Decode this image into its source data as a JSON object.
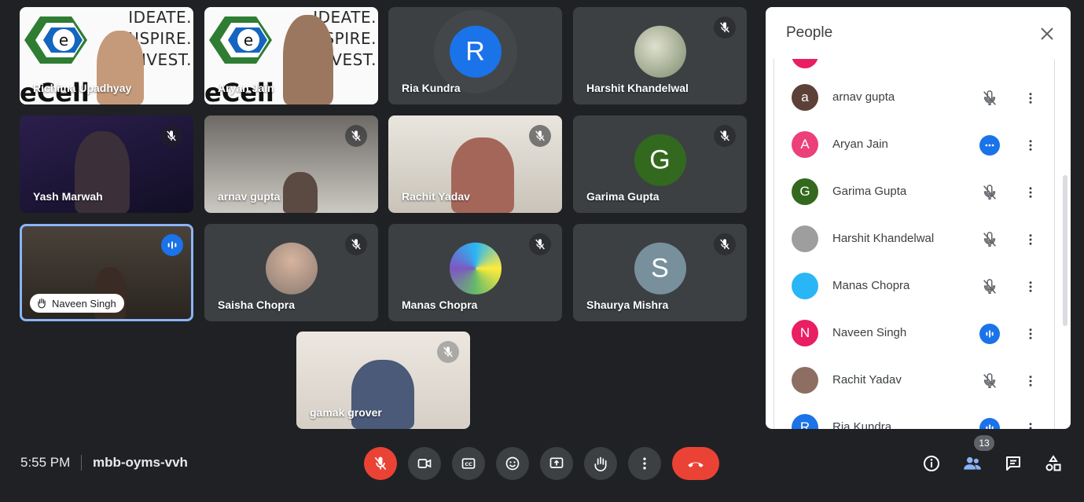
{
  "tiles": [
    {
      "name": "Richima Upadhyay"
    },
    {
      "name": "Aryan Jain"
    },
    {
      "name": "Ria Kundra",
      "initial": "R"
    },
    {
      "name": "Harshit Khandelwal"
    },
    {
      "name": "Yash Marwah"
    },
    {
      "name": "arnav gupta"
    },
    {
      "name": "Rachit Yadav"
    },
    {
      "name": "Garima Gupta",
      "initial": "G"
    },
    {
      "name": "Naveen Singh"
    },
    {
      "name": "Saisha Chopra"
    },
    {
      "name": "Manas Chopra"
    },
    {
      "name": "Shaurya Mishra",
      "initial": "S"
    },
    {
      "name": "gamak grover"
    }
  ],
  "logo": {
    "line1": "IDEATE.",
    "line2": "INSPIRE.",
    "line3": "INVEST.",
    "brand": "eCell IIT"
  },
  "meeting": {
    "time": "5:55 PM",
    "code": "mbb-oyms-vvh",
    "participant_count": "13"
  },
  "panel": {
    "title": "People",
    "people": [
      {
        "name": "arnav gupta",
        "initial": "a",
        "color": "#5d4037",
        "status": "muted"
      },
      {
        "name": "Aryan Jain",
        "initial": "A",
        "color": "#ec407a",
        "status": "speaking-dots"
      },
      {
        "name": "Garima Gupta",
        "initial": "G",
        "color": "#33691e",
        "status": "muted"
      },
      {
        "name": "Harshit Khandelwal",
        "initial": "",
        "color": "#9e9e9e",
        "status": "muted"
      },
      {
        "name": "Manas Chopra",
        "initial": "",
        "color": "#29b6f6",
        "status": "muted"
      },
      {
        "name": "Naveen Singh",
        "initial": "N",
        "color": "#e91e63",
        "status": "speaking"
      },
      {
        "name": "Rachit Yadav",
        "initial": "",
        "color": "#8d6e63",
        "status": "muted"
      },
      {
        "name": "Ria Kundra",
        "initial": "R",
        "color": "#1a73e8",
        "status": "speaking"
      }
    ]
  },
  "colors": {
    "accent": "#1a73e8",
    "danger": "#ea4335",
    "tile": "#3c4043",
    "background": "#202124"
  }
}
